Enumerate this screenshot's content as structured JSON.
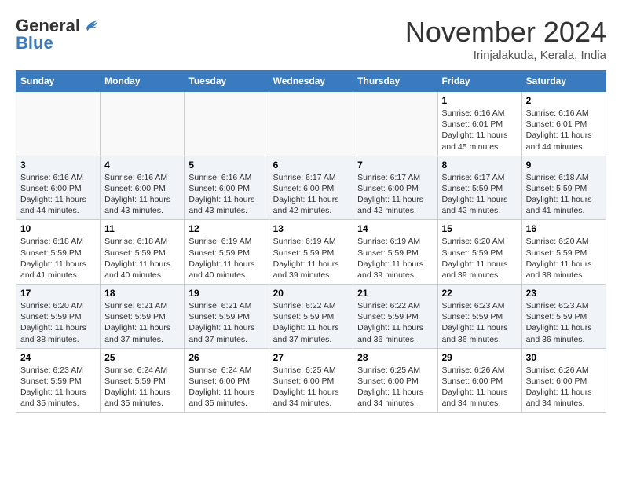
{
  "logo": {
    "general": "General",
    "blue": "Blue"
  },
  "title": "November 2024",
  "location": "Irinjalakuda, Kerala, India",
  "weekdays": [
    "Sunday",
    "Monday",
    "Tuesday",
    "Wednesday",
    "Thursday",
    "Friday",
    "Saturday"
  ],
  "weeks": [
    [
      {
        "day": "",
        "info": ""
      },
      {
        "day": "",
        "info": ""
      },
      {
        "day": "",
        "info": ""
      },
      {
        "day": "",
        "info": ""
      },
      {
        "day": "",
        "info": ""
      },
      {
        "day": "1",
        "info": "Sunrise: 6:16 AM\nSunset: 6:01 PM\nDaylight: 11 hours\nand 45 minutes."
      },
      {
        "day": "2",
        "info": "Sunrise: 6:16 AM\nSunset: 6:01 PM\nDaylight: 11 hours\nand 44 minutes."
      }
    ],
    [
      {
        "day": "3",
        "info": "Sunrise: 6:16 AM\nSunset: 6:00 PM\nDaylight: 11 hours\nand 44 minutes."
      },
      {
        "day": "4",
        "info": "Sunrise: 6:16 AM\nSunset: 6:00 PM\nDaylight: 11 hours\nand 43 minutes."
      },
      {
        "day": "5",
        "info": "Sunrise: 6:16 AM\nSunset: 6:00 PM\nDaylight: 11 hours\nand 43 minutes."
      },
      {
        "day": "6",
        "info": "Sunrise: 6:17 AM\nSunset: 6:00 PM\nDaylight: 11 hours\nand 42 minutes."
      },
      {
        "day": "7",
        "info": "Sunrise: 6:17 AM\nSunset: 6:00 PM\nDaylight: 11 hours\nand 42 minutes."
      },
      {
        "day": "8",
        "info": "Sunrise: 6:17 AM\nSunset: 5:59 PM\nDaylight: 11 hours\nand 42 minutes."
      },
      {
        "day": "9",
        "info": "Sunrise: 6:18 AM\nSunset: 5:59 PM\nDaylight: 11 hours\nand 41 minutes."
      }
    ],
    [
      {
        "day": "10",
        "info": "Sunrise: 6:18 AM\nSunset: 5:59 PM\nDaylight: 11 hours\nand 41 minutes."
      },
      {
        "day": "11",
        "info": "Sunrise: 6:18 AM\nSunset: 5:59 PM\nDaylight: 11 hours\nand 40 minutes."
      },
      {
        "day": "12",
        "info": "Sunrise: 6:19 AM\nSunset: 5:59 PM\nDaylight: 11 hours\nand 40 minutes."
      },
      {
        "day": "13",
        "info": "Sunrise: 6:19 AM\nSunset: 5:59 PM\nDaylight: 11 hours\nand 39 minutes."
      },
      {
        "day": "14",
        "info": "Sunrise: 6:19 AM\nSunset: 5:59 PM\nDaylight: 11 hours\nand 39 minutes."
      },
      {
        "day": "15",
        "info": "Sunrise: 6:20 AM\nSunset: 5:59 PM\nDaylight: 11 hours\nand 39 minutes."
      },
      {
        "day": "16",
        "info": "Sunrise: 6:20 AM\nSunset: 5:59 PM\nDaylight: 11 hours\nand 38 minutes."
      }
    ],
    [
      {
        "day": "17",
        "info": "Sunrise: 6:20 AM\nSunset: 5:59 PM\nDaylight: 11 hours\nand 38 minutes."
      },
      {
        "day": "18",
        "info": "Sunrise: 6:21 AM\nSunset: 5:59 PM\nDaylight: 11 hours\nand 37 minutes."
      },
      {
        "day": "19",
        "info": "Sunrise: 6:21 AM\nSunset: 5:59 PM\nDaylight: 11 hours\nand 37 minutes."
      },
      {
        "day": "20",
        "info": "Sunrise: 6:22 AM\nSunset: 5:59 PM\nDaylight: 11 hours\nand 37 minutes."
      },
      {
        "day": "21",
        "info": "Sunrise: 6:22 AM\nSunset: 5:59 PM\nDaylight: 11 hours\nand 36 minutes."
      },
      {
        "day": "22",
        "info": "Sunrise: 6:23 AM\nSunset: 5:59 PM\nDaylight: 11 hours\nand 36 minutes."
      },
      {
        "day": "23",
        "info": "Sunrise: 6:23 AM\nSunset: 5:59 PM\nDaylight: 11 hours\nand 36 minutes."
      }
    ],
    [
      {
        "day": "24",
        "info": "Sunrise: 6:23 AM\nSunset: 5:59 PM\nDaylight: 11 hours\nand 35 minutes."
      },
      {
        "day": "25",
        "info": "Sunrise: 6:24 AM\nSunset: 5:59 PM\nDaylight: 11 hours\nand 35 minutes."
      },
      {
        "day": "26",
        "info": "Sunrise: 6:24 AM\nSunset: 6:00 PM\nDaylight: 11 hours\nand 35 minutes."
      },
      {
        "day": "27",
        "info": "Sunrise: 6:25 AM\nSunset: 6:00 PM\nDaylight: 11 hours\nand 34 minutes."
      },
      {
        "day": "28",
        "info": "Sunrise: 6:25 AM\nSunset: 6:00 PM\nDaylight: 11 hours\nand 34 minutes."
      },
      {
        "day": "29",
        "info": "Sunrise: 6:26 AM\nSunset: 6:00 PM\nDaylight: 11 hours\nand 34 minutes."
      },
      {
        "day": "30",
        "info": "Sunrise: 6:26 AM\nSunset: 6:00 PM\nDaylight: 11 hours\nand 34 minutes."
      }
    ]
  ]
}
